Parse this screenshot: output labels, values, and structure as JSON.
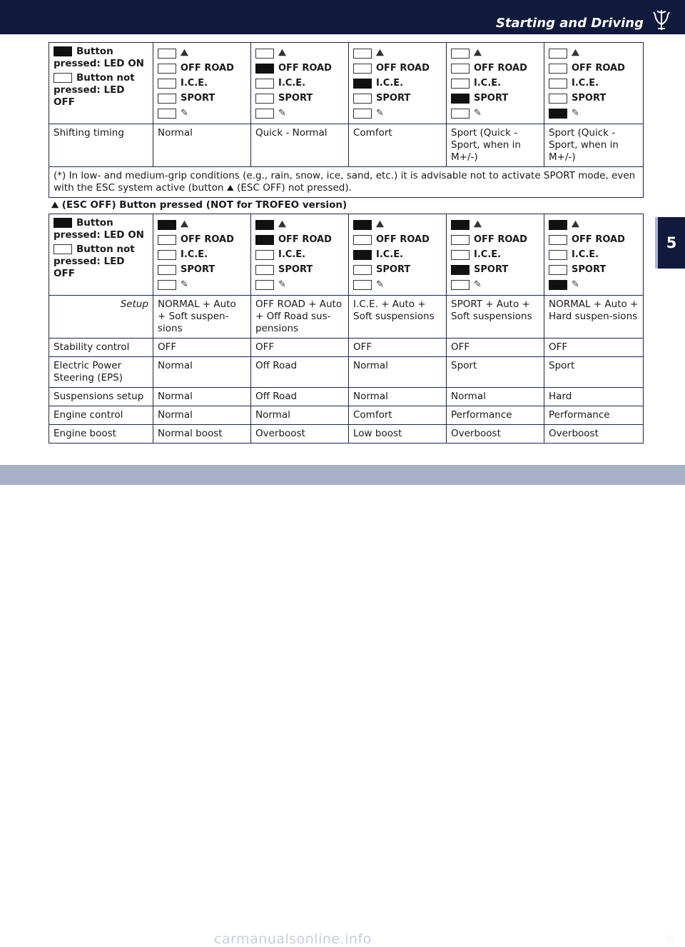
{
  "header": {
    "section_title": "Starting and Driving"
  },
  "chapter_tab": "5",
  "legend": {
    "on_label": "Button pressed: LED ON",
    "off_label": "Button not pressed: LED OFF"
  },
  "mode_labels": [
    "OFF ROAD",
    "I.C.E.",
    "SPORT"
  ],
  "table1": {
    "leds": [
      [
        false,
        false,
        false,
        false,
        false
      ],
      [
        false,
        true,
        false,
        false,
        false
      ],
      [
        false,
        false,
        true,
        false,
        false
      ],
      [
        false,
        false,
        false,
        true,
        false
      ],
      [
        false,
        false,
        false,
        false,
        true
      ]
    ],
    "row_label": "Shifting timing",
    "values": [
      "Normal",
      "Quick - Normal",
      "Comfort",
      "Sport (Quick - Sport, when in M+/-)",
      "Sport (Quick - Sport, when in M+/-)"
    ],
    "note_part1": "(*) In low- and medium-grip conditions (e.g., rain, snow, ice, sand, etc.) it is advisable not to activate SPORT mode, even with the ESC system active (button",
    "note_part2": "(ESC OFF) not pressed)."
  },
  "table2_caption": "(ESC OFF) Button pressed (NOT for TROFEO version)",
  "table2": {
    "leds": [
      [
        true,
        false,
        false,
        false,
        false
      ],
      [
        true,
        true,
        false,
        false,
        false
      ],
      [
        true,
        false,
        true,
        false,
        false
      ],
      [
        true,
        false,
        false,
        true,
        false
      ],
      [
        true,
        false,
        false,
        false,
        true
      ]
    ],
    "rows": [
      {
        "label": "Setup",
        "values": [
          "NORMAL + Auto + Soft suspen-sions",
          "OFF ROAD + Auto + Off Road sus-pensions",
          "I.C.E. + Auto + Soft suspensions",
          "SPORT + Auto + Soft suspensions",
          "NORMAL + Auto + Hard suspen-sions"
        ]
      },
      {
        "label": "Stability control",
        "values": [
          "OFF",
          "OFF",
          "OFF",
          "OFF",
          "OFF"
        ]
      },
      {
        "label": "Electric Power Steering (EPS)",
        "values": [
          "Normal",
          "Off Road",
          "Normal",
          "Sport",
          "Sport"
        ]
      },
      {
        "label": "Suspensions setup",
        "values": [
          "Normal",
          "Off Road",
          "Normal",
          "Normal",
          "Hard"
        ]
      },
      {
        "label": "Engine control",
        "values": [
          "Normal",
          "Normal",
          "Comfort",
          "Performance",
          "Performance"
        ]
      },
      {
        "label": "Engine boost",
        "values": [
          "Normal boost",
          "Overboost",
          "Low boost",
          "Overboost",
          "Overboost"
        ]
      }
    ]
  },
  "footer": {
    "page_number": "85",
    "watermark": "carmanualsonline.info"
  },
  "icons": {
    "esc": "esc-off-car-skid-icon",
    "manual": "manual-mode-pen-icon"
  }
}
